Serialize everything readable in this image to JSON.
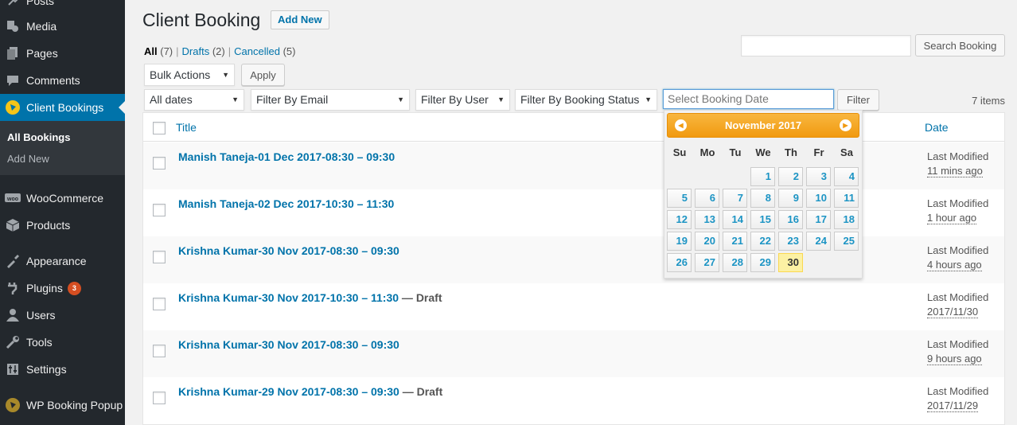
{
  "sidebar": {
    "items": [
      {
        "label": "Posts",
        "icon": "pin-icon"
      },
      {
        "label": "Media",
        "icon": "media-icon"
      },
      {
        "label": "Pages",
        "icon": "pages-icon"
      },
      {
        "label": "Comments",
        "icon": "comments-icon"
      },
      {
        "label": "Client Bookings",
        "icon": "client-bookings-icon"
      },
      {
        "label": "WooCommerce",
        "icon": "woocommerce-icon"
      },
      {
        "label": "Products",
        "icon": "products-icon"
      },
      {
        "label": "Appearance",
        "icon": "appearance-icon"
      },
      {
        "label": "Plugins",
        "icon": "plugins-icon",
        "badge": "3"
      },
      {
        "label": "Users",
        "icon": "users-icon"
      },
      {
        "label": "Tools",
        "icon": "tools-icon"
      },
      {
        "label": "Settings",
        "icon": "settings-icon"
      },
      {
        "label": "WP Booking Popup",
        "icon": "wp-booking-popup-icon"
      }
    ],
    "submenu": [
      "All Bookings",
      "Add New"
    ]
  },
  "header": {
    "title": "Client Booking",
    "add_new": "Add New"
  },
  "views": {
    "all": "All",
    "all_count": "(7)",
    "drafts": "Drafts",
    "drafts_count": "(2)",
    "cancelled": "Cancelled",
    "cancelled_count": "(5)",
    "sep": "|"
  },
  "search": {
    "button": "Search Booking"
  },
  "bulk": {
    "select": "Bulk Actions",
    "apply": "Apply"
  },
  "filters": {
    "dates": "All dates",
    "email": "Filter By Email",
    "user": "Filter By User",
    "status": "Filter By Booking Status",
    "date_placeholder": "Select Booking Date",
    "button": "Filter",
    "items": "7 items"
  },
  "table": {
    "col_title": "Title",
    "col_date": "Date",
    "rows": [
      {
        "title": "Manish Taneja-01 Dec 2017-08:30 – 09:30",
        "state": "",
        "modified": "Last Modified",
        "time": "11 mins ago"
      },
      {
        "title": "Manish Taneja-02 Dec 2017-10:30 – 11:30",
        "state": "",
        "modified": "Last Modified",
        "time": "1 hour ago"
      },
      {
        "title": "Krishna Kumar-30 Nov 2017-08:30 – 09:30",
        "state": "",
        "modified": "Last Modified",
        "time": "4 hours ago"
      },
      {
        "title": "Krishna Kumar-30 Nov 2017-10:30 – 11:30",
        "state": " — Draft",
        "modified": "Last Modified",
        "time": "2017/11/30"
      },
      {
        "title": "Krishna Kumar-30 Nov 2017-08:30 – 09:30",
        "state": "",
        "modified": "Last Modified",
        "time": "9 hours ago"
      },
      {
        "title": "Krishna Kumar-29 Nov 2017-08:30 – 09:30",
        "state": " — Draft",
        "modified": "Last Modified",
        "time": "2017/11/29"
      }
    ]
  },
  "datepicker": {
    "month": "November 2017",
    "weekdays": [
      "Su",
      "Mo",
      "Tu",
      "We",
      "Th",
      "Fr",
      "Sa"
    ],
    "days": [
      "1",
      "2",
      "3",
      "4",
      "5",
      "6",
      "7",
      "8",
      "9",
      "10",
      "11",
      "12",
      "13",
      "14",
      "15",
      "16",
      "17",
      "18",
      "19",
      "20",
      "21",
      "22",
      "23",
      "24",
      "25",
      "26",
      "27",
      "28",
      "29",
      "30"
    ],
    "first_weekday": 3,
    "today": "30"
  },
  "colors": {
    "accent": "#0073aa",
    "sidebar": "#23282d",
    "datepicker_header": "#f19a10",
    "badge": "#d54e21"
  }
}
